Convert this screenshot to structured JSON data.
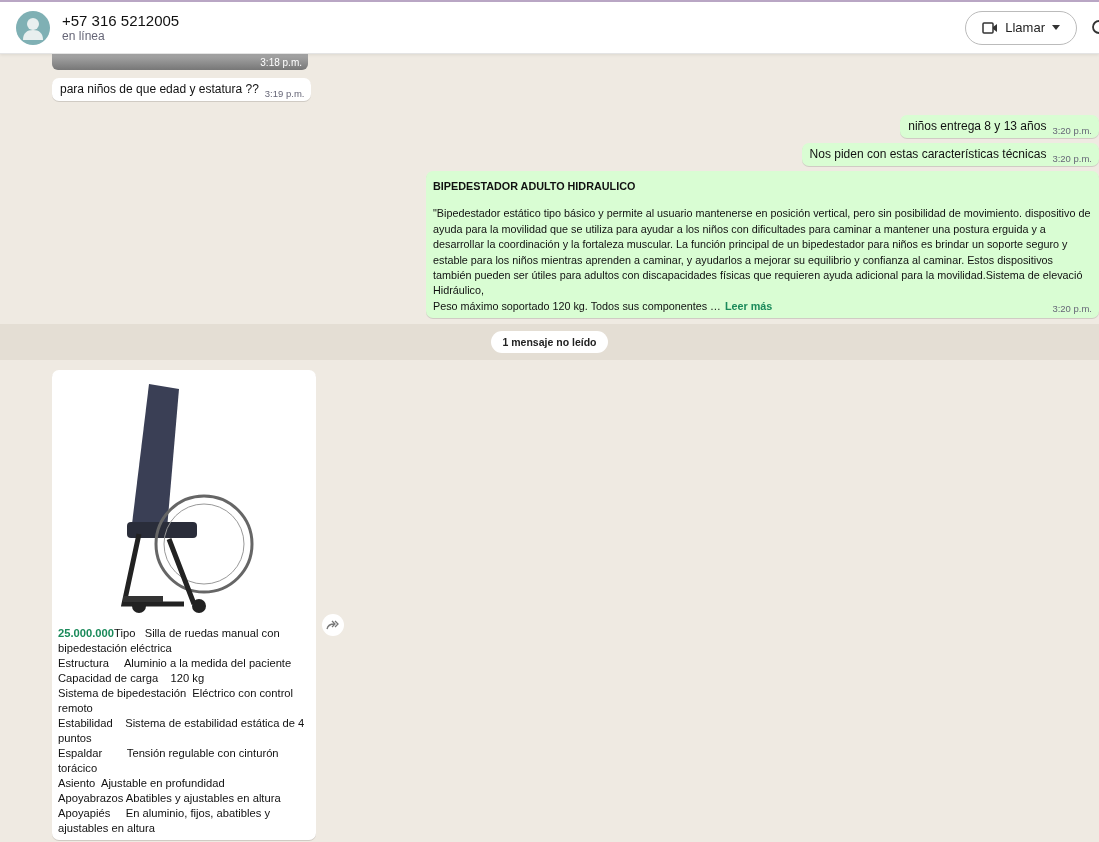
{
  "header": {
    "name": "+57 316 5212005",
    "status": "en línea",
    "call_button": "Llamar"
  },
  "messages": [
    {
      "kind": "image_in",
      "time": "3:18 p.m."
    },
    {
      "kind": "text_in",
      "text": "para niños de que edad y estatura ??",
      "time": "3:19 p.m."
    },
    {
      "kind": "text_out",
      "text": "niños entrega 8 y 13 años",
      "time": "3:20 p.m."
    },
    {
      "kind": "text_out",
      "text": "Nos piden con estas características técnicas",
      "time": "3:20 p.m."
    },
    {
      "kind": "long_out",
      "title": "BIPEDESTADOR ADULTO HIDRAULICO",
      "text": "\"Bipedestador estático tipo básico y permite al usuario mantenerse en posición vertical, pero sin posibilidad de movimiento. dispositivo de ayuda para la movilidad que se utiliza para ayudar a los niños con dificultades para caminar a mantener una postura erguida y a desarrollar la coordinación y la fortaleza muscular. La función principal de un bipedestador para niños es brindar un soporte seguro y estable para los niños mientras aprenden a caminar, y ayudarlos a mejorar su equilibrio y confianza al caminar. Estos dispositivos también pueden ser útiles para adultos con discapacidades físicas que requieren ayuda adicional para la movilidad.Sistema de elevació\nHidráulico,",
      "last_line": "Peso máximo soportado 120 kg. Todos sus componentes …",
      "more": "Leer más",
      "time": "3:20 p.m."
    },
    {
      "kind": "divider",
      "text": "1 mensaje no leído"
    },
    {
      "kind": "product_in",
      "lines": [
        "**25.000.000**Tipo   Silla de ruedas manual con bipedestación eléctrica",
        "Estructura     Aluminio a la medida del paciente",
        "Capacidad de carga    120 kg",
        "Sistema de bipedestación  Eléctrico con control remoto",
        "Estabilidad    Sistema de estabilidad estática de 4 puntos",
        "Espaldar        Tensión regulable con cinturón torácico",
        "Asiento  Ajustable en profundidad",
        "Apoyabrazos Abatibles y ajustables en altura",
        "Apoyapiés     En aluminio, fijos, abatibles y ajustables en altura"
      ]
    }
  ]
}
